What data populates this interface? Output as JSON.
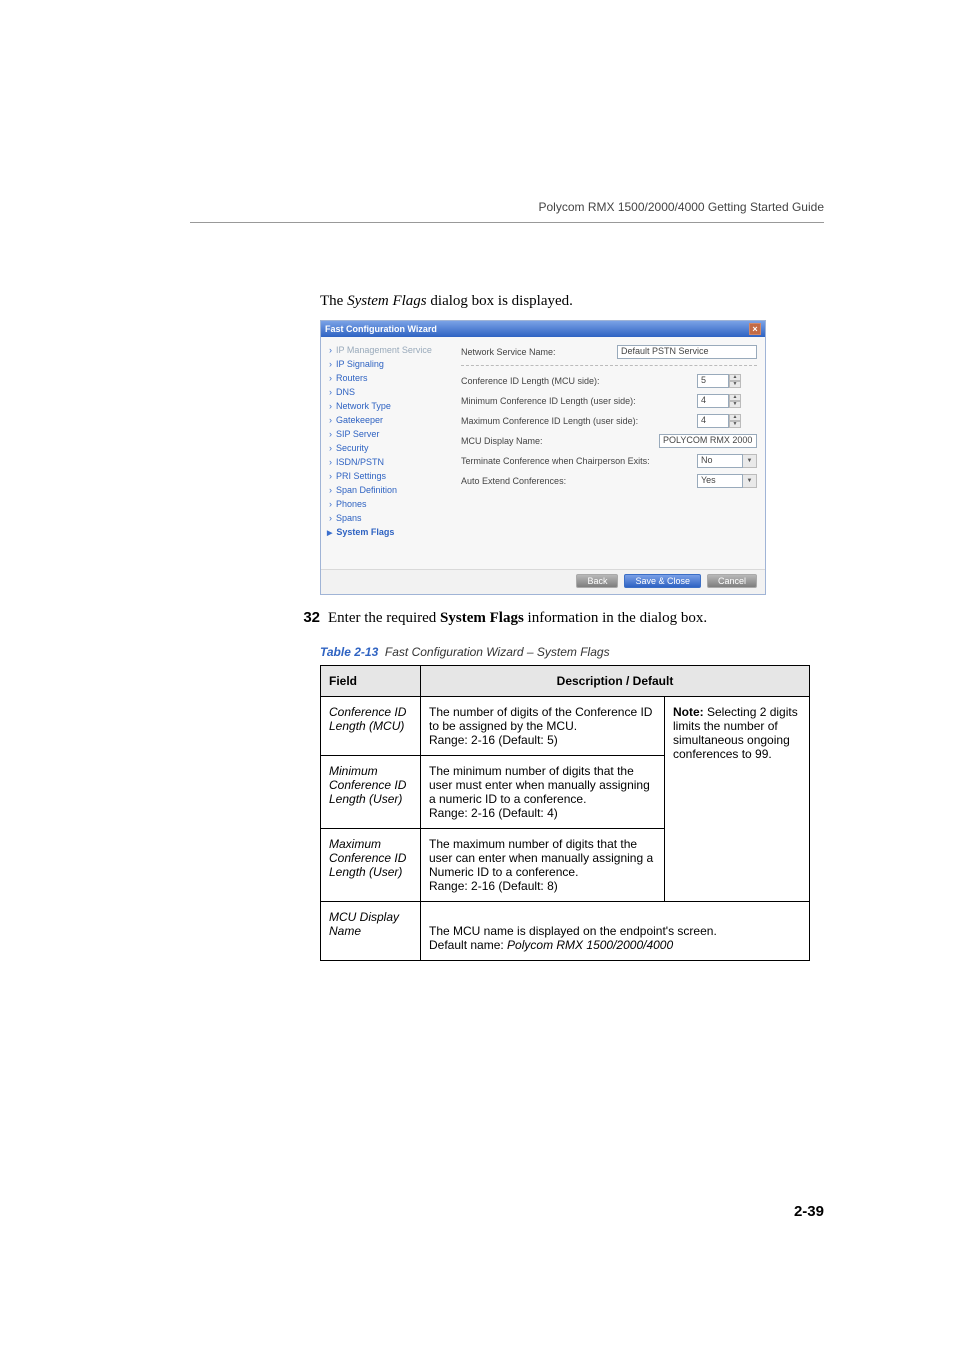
{
  "header": "Polycom RMX 1500/2000/4000 Getting Started Guide",
  "intro_prefix": "The ",
  "intro_italic": "System Flags",
  "intro_suffix": " dialog box is displayed.",
  "wizard": {
    "title": "Fast Configuration Wizard",
    "nav": {
      "ip_mgmt": "IP Management Service",
      "ip_sig": "IP Signaling",
      "routers": "Routers",
      "dns": "DNS",
      "net_type": "Network Type",
      "gatekeeper": "Gatekeeper",
      "sip": "SIP Server",
      "security": "Security",
      "isdn": "ISDN/PSTN",
      "pri": "PRI Settings",
      "span_def": "Span Definition",
      "phones": "Phones",
      "spans": "Spans",
      "sysflags": "System Flags"
    },
    "fields": {
      "net_svc_label": "Network Service Name:",
      "net_svc_value": "Default PSTN Service",
      "conf_id_len_label": "Conference ID Length (MCU side):",
      "conf_id_len_value": "5",
      "min_conf_len_label": "Minimum Conference ID Length (user side):",
      "min_conf_len_value": "4",
      "max_conf_len_label": "Maximum Conference ID Length (user side):",
      "max_conf_len_value": "4",
      "mcu_disp_label": "MCU Display Name:",
      "mcu_disp_value": "POLYCOM RMX 2000",
      "terminate_label": "Terminate Conference when Chairperson Exits:",
      "terminate_value": "No",
      "auto_extend_label": "Auto Extend Conferences:",
      "auto_extend_value": "Yes"
    },
    "buttons": {
      "back": "Back",
      "save": "Save & Close",
      "cancel": "Cancel"
    }
  },
  "step": {
    "num": "32",
    "pre": "Enter the required ",
    "bold": "System Flags",
    "post": " information in the dialog box."
  },
  "table_caption": {
    "blue": "Table 2-13",
    "rest": "Fast Configuration Wizard – System Flags"
  },
  "table": {
    "head_field": "Field",
    "head_desc": "Description / Default",
    "r1_field": "Conference ID Length (MCU)",
    "r1_desc": "The number of digits of the Conference ID to be assigned by the MCU.\nRange: 2-16 (Default: 5)",
    "r2_field": "Minimum Conference ID Length (User)",
    "r2_desc": "The minimum number of digits that the user must enter when manually assigning a numeric ID to a conference.\nRange: 2-16 (Default: 4)",
    "r3_field": "Maximum Conference ID Length (User)",
    "r3_desc": "The maximum number of digits that the user can enter when manually assigning a Numeric ID to a conference.\nRange: 2-16 (Default: 8)",
    "note_bold": "Note:",
    "note_text": " Selecting 2 digits limits the number of simultaneous ongoing conferences to 99.",
    "r4_field": "MCU Display Name",
    "r4_desc_pre": "The MCU name is displayed on the endpoint's screen.\nDefault name: ",
    "r4_desc_italic": "Polycom RMX 1500/2000/4000"
  },
  "page_num": "2-39"
}
